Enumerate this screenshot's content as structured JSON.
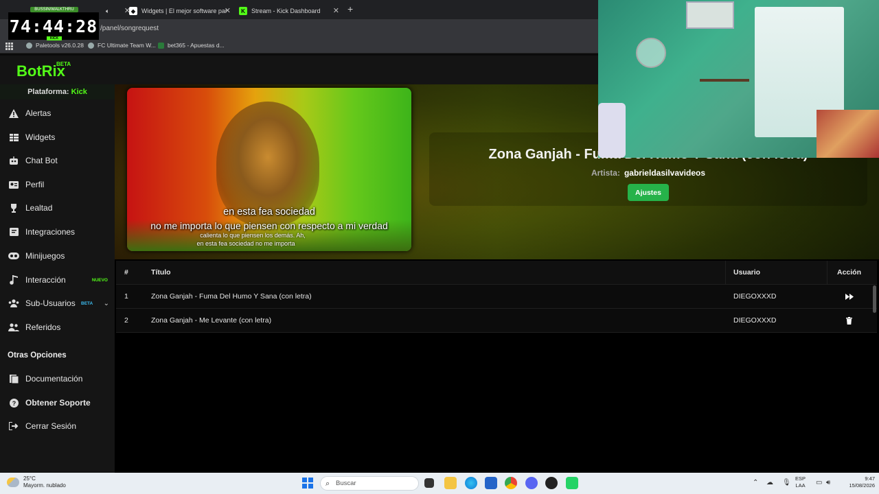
{
  "browser": {
    "timer": "74:44:28",
    "timer_top": "BUSSIN/WALKTHRU",
    "timer_bottom": "KICK",
    "tabs": [
      {
        "title": "Widgets | El mejor software par"
      },
      {
        "title": "Stream - Kick Dashboard"
      }
    ],
    "url_visible": "/panel/songrequest",
    "bookmarks": [
      {
        "label": "Paletools v26.0.28"
      },
      {
        "label": "FC Ultimate Team W..."
      },
      {
        "label": "bet365 - Apuestas d..."
      }
    ]
  },
  "app": {
    "logo": "BotRix",
    "logo_badge": "BETA",
    "platform_label": "Plataforma:",
    "platform_value": "Kick"
  },
  "sidebar": {
    "items": [
      {
        "label": "Alertas",
        "icon": "warning-icon"
      },
      {
        "label": "Widgets",
        "icon": "grid-icon"
      },
      {
        "label": "Chat Bot",
        "icon": "robot-icon"
      },
      {
        "label": "Perfil",
        "icon": "id-card-icon"
      },
      {
        "label": "Lealtad",
        "icon": "trophy-icon"
      },
      {
        "label": "Integraciones",
        "icon": "plug-icon"
      },
      {
        "label": "Minijuegos",
        "icon": "gamepad-icon"
      },
      {
        "label": "Interacción",
        "icon": "music-icon",
        "badge": "NUEVO"
      },
      {
        "label": "Sub-Usuarios",
        "icon": "users-icon",
        "badge": "BETA"
      },
      {
        "label": "Referidos",
        "icon": "user-group-icon"
      }
    ],
    "section_title": "Otras Opciones",
    "other_items": [
      {
        "label": "Documentación",
        "icon": "book-icon"
      },
      {
        "label": "Obtener Soporte",
        "icon": "question-icon"
      },
      {
        "label": "Cerrar Sesión",
        "icon": "logout-icon"
      }
    ]
  },
  "player": {
    "subtitle_line1": "en esta fea sociedad",
    "subtitle_line2": "no me importa lo que piensen con respecto a mi verdad",
    "subtitle_small1": "calienta lo que piensen los demás. Ah,",
    "subtitle_small2": "en esta fea sociedad no me importa",
    "song_title": "Zona Ganjah - Fuma Del Humo Y Sana (con letra)",
    "artist_label": "Artista:",
    "artist_value": "gabrieldasilvavideos",
    "settings_button": "Ajustes"
  },
  "queue": {
    "headers": {
      "num": "#",
      "title": "Título",
      "user": "Usuario",
      "action": "Acción"
    },
    "rows": [
      {
        "num": "1",
        "title": "Zona Ganjah - Fuma Del Humo Y Sana (con letra)",
        "user": "DIEGOXXXD",
        "action_icon": "skip-forward-icon"
      },
      {
        "num": "2",
        "title": "Zona Ganjah - Me Levante (con letra)",
        "user": "DIEGOXXXD",
        "action_icon": "trash-icon"
      }
    ]
  },
  "taskbar": {
    "temperature": "25°C",
    "weather": "Mayorm. nublado",
    "search_placeholder": "Buscar",
    "lang_top": "ESP",
    "lang_bottom": "LAA",
    "time": "9:47",
    "date": "15/08/2026"
  },
  "colors": {
    "accent": "#53fc18",
    "button": "#26b24a"
  }
}
